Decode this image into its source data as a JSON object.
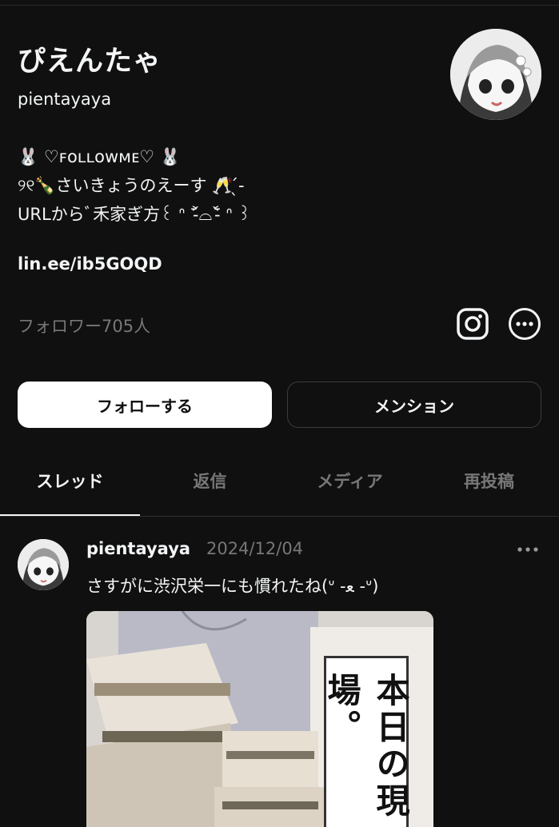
{
  "profile": {
    "display_name": "ぴえんたゃ",
    "handle": "pientayaya",
    "bio_lines": [
      "🐰 ♡ꜰᴏʟʟᴏᴡᴍᴇ♡ 🐰",
      "୨୧🍾さいきょうのえーす 🥂 ̖́-",
      "URLからﾞ禾家ぎ方꒰ ᐢ ˃̵᷄⌓˂̵᷅ ᐢ ꒱"
    ],
    "link": "lin.ee/ib5GOQD",
    "followers": "フォロワー705人"
  },
  "actions": {
    "follow_label": "フォローする",
    "mention_label": "メンション"
  },
  "tabs": [
    {
      "label": "スレッド",
      "active": true
    },
    {
      "label": "返信",
      "active": false
    },
    {
      "label": "メディア",
      "active": false
    },
    {
      "label": "再投稿",
      "active": false
    }
  ],
  "post": {
    "username": "pientayaya",
    "date": "2024/12/04",
    "text": "さすがに渋沢栄一にも慣れたね(ᐡ -ﻌ -ᐡ)",
    "image_caption": "本日の現場。"
  },
  "icons": {
    "instagram": "instagram-icon",
    "more": "more-circle-icon",
    "post_more": "ellipsis-icon"
  },
  "colors": {
    "background": "#101010",
    "text": "#f3f5f7",
    "muted": "#777777"
  }
}
